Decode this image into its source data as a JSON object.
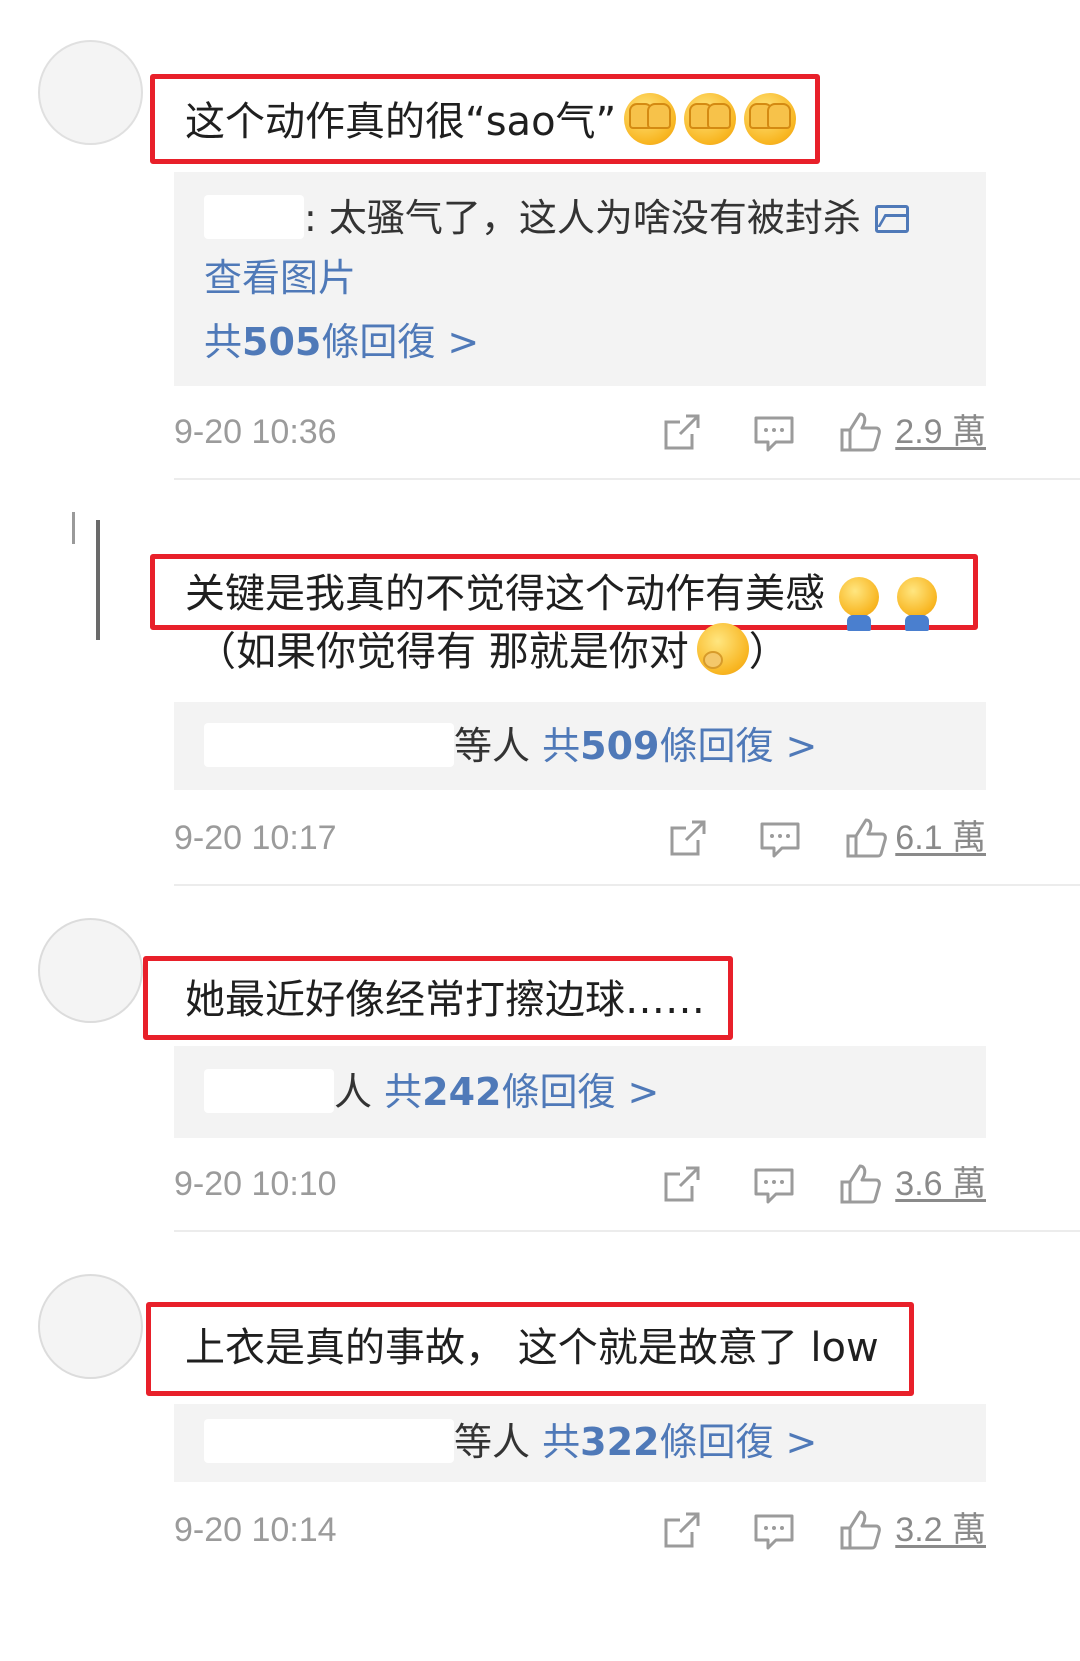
{
  "comments": [
    {
      "main_text": "这个动作真的很“sao气”",
      "reply_preview": ": 太骚气了，这人为啥没有被封杀",
      "view_image": "查看图片",
      "replies_prefix": "共",
      "replies_count": "505",
      "replies_suffix": "條回復 >",
      "time": "9-20 10:36",
      "likes": "2.9 萬"
    },
    {
      "main_text": "关键是我真的不觉得这个动作有美感",
      "sub_text": "（如果你觉得有 那就是你对",
      "sub_text_end": "）",
      "reply_others": "等人",
      "replies_prefix": "共",
      "replies_count": "509",
      "replies_suffix": "條回復 >",
      "time": "9-20 10:17",
      "likes": "6.1 萬"
    },
    {
      "main_text": "她最近好像经常打擦边球……",
      "reply_others": "人",
      "replies_prefix": "共",
      "replies_count": "242",
      "replies_suffix": "條回復 >",
      "time": "9-20 10:10",
      "likes": "3.6 萬"
    },
    {
      "main_text": "上衣是真的事故，  这个就是故意了 low",
      "reply_others": "等人",
      "replies_prefix": "共",
      "replies_count": "322",
      "replies_suffix": "條回復 >",
      "time": "9-20 10:14",
      "likes": "3.2 萬"
    }
  ],
  "icons": {
    "share": "share-icon",
    "comment": "comment-icon",
    "like": "thumbs-up-icon",
    "image": "image-icon"
  },
  "colors": {
    "highlight_border": "#e8202a",
    "link": "#4f79b8",
    "meta": "#9b9b9b",
    "reply_bg": "#f3f3f3"
  }
}
